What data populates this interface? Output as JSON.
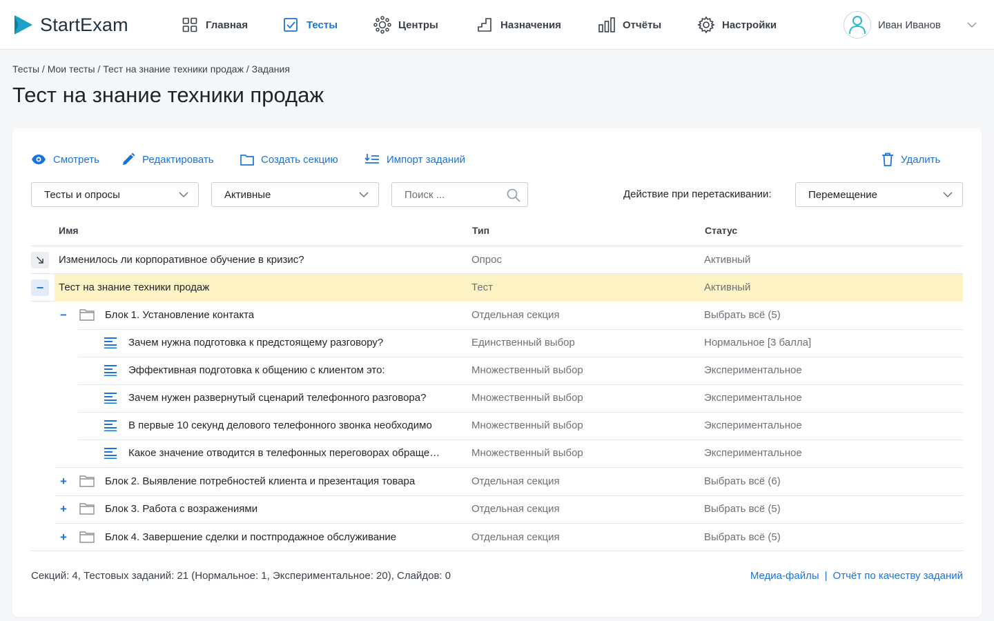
{
  "app": {
    "logo_text": "StartExam",
    "brand_color": "#1aa3c7",
    "accent_color": "#1a73d9"
  },
  "nav": {
    "items": [
      {
        "label": "Главная",
        "icon": "grid-icon"
      },
      {
        "label": "Тесты",
        "icon": "checkbox-icon",
        "active": true
      },
      {
        "label": "Центры",
        "icon": "centers-icon"
      },
      {
        "label": "Назначения",
        "icon": "steps-icon"
      },
      {
        "label": "Отчёты",
        "icon": "bar-chart-icon"
      },
      {
        "label": "Настройки",
        "icon": "gear-icon"
      }
    ]
  },
  "user": {
    "name": "Иван Иванов"
  },
  "breadcrumb": [
    "Тесты",
    "Мои тесты",
    "Тест на знание техники продаж",
    "Задания"
  ],
  "page_title": "Тест на знание техники продаж",
  "actions": {
    "view": "Смотреть",
    "edit": "Редактировать",
    "create_section": "Создать секцию",
    "import": "Импорт заданий",
    "delete": "Удалить"
  },
  "filters": {
    "kind": "Тесты и опросы",
    "status": "Активные",
    "search_placeholder": "Поиск ...",
    "drag_label": "Действие при перетаскивании:",
    "drag_action": "Перемещение"
  },
  "table": {
    "headers": {
      "name": "Имя",
      "type": "Тип",
      "status": "Статус"
    },
    "rows": [
      {
        "name": "Изменилось ли корпоративное обучение в кризис?",
        "type": "Опрос",
        "status": "Активный"
      },
      {
        "name": "Тест на знание техники продаж",
        "type": "Тест",
        "status": "Активный",
        "highlight": true,
        "toggle": "−"
      },
      {
        "name": "Блок 1. Установление контакта",
        "type": "Отдельная секция",
        "status": "Выбрать всё (5)",
        "toggle": "−"
      },
      {
        "name": "Зачем нужна подготовка к предстоящему разговору?",
        "type": "Единственный выбор",
        "status": "Нормальное [3 балла]"
      },
      {
        "name": "Эффективная подготовка к общению с клиентом это:",
        "type": "Множественный выбор",
        "status": "Экспериментальное"
      },
      {
        "name": "Зачем нужен развернутый сценарий телефонного разговора?",
        "type": "Множественный выбор",
        "status": "Экспериментальное"
      },
      {
        "name": "В первые 10 секунд делового телефонного звонка необходимо",
        "type": "Множественный выбор",
        "status": "Экспериментальное"
      },
      {
        "name": "Какое значение отводится в телефонных переговорах обращению по имени",
        "type": "Множественный выбор",
        "status": "Экспериментальное"
      },
      {
        "name": "Блок 2. Выявление потребностей клиента и презентация товара",
        "type": "Отдельная секция",
        "status": "Выбрать всё (6)",
        "toggle": "+"
      },
      {
        "name": "Блок 3. Работа с возражениями",
        "type": "Отдельная секция",
        "status": "Выбрать всё (5)",
        "toggle": "+"
      },
      {
        "name": "Блок 4. Завершение сделки и постпродажное обслуживание",
        "type": "Отдельная секция",
        "status": "Выбрать всё (5)",
        "toggle": "+"
      }
    ]
  },
  "footer": {
    "summary": "Секций: 4, Тестовых заданий: 21 (Нормальное: 1, Экспериментальное: 20), Слайдов: 0",
    "link_media": "Медиа-файлы",
    "link_report": "Отчёт по качеству заданий"
  }
}
